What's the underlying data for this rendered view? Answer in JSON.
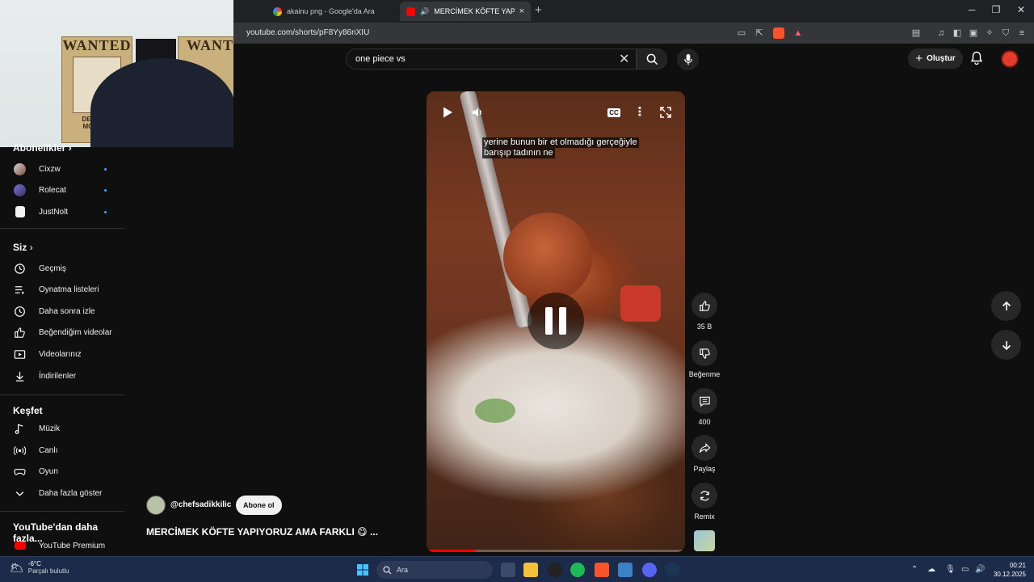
{
  "browser": {
    "tabs": [
      {
        "title": "akainu png - Google'da Ara",
        "active": false
      },
      {
        "title": "MERCİMEK KÖFTE YAPIYORUZ",
        "active": true
      }
    ],
    "url": "youtube.com/shorts/pF8Yy86nXIU",
    "new_tab_glyph": "+",
    "close_glyph": "×"
  },
  "webcam": {
    "poster_left_text": "WANTED",
    "poster_right_text": "WANT",
    "poster_name": "MONKEY",
    "poster_dead": "DEAD OR"
  },
  "youtube": {
    "search_value": "one piece vs",
    "create_label": "Oluştur",
    "brand_color": "#ff0000"
  },
  "sidebar": {
    "subscriptions_heading": "Abonelikler",
    "subscriptions": [
      {
        "name": "Cixzw"
      },
      {
        "name": "Rolecat"
      },
      {
        "name": "JustNolt"
      }
    ],
    "you_heading": "Siz",
    "you_items": [
      {
        "label": "Geçmiş",
        "icon": "history-icon"
      },
      {
        "label": "Oynatma listeleri",
        "icon": "playlist-icon"
      },
      {
        "label": "Daha sonra izle",
        "icon": "clock-icon"
      },
      {
        "label": "Beğendiğim videolar",
        "icon": "thumb-up-icon"
      },
      {
        "label": "Videolarınız",
        "icon": "video-icon"
      },
      {
        "label": "İndirilenler",
        "icon": "download-icon"
      }
    ],
    "explore_heading": "Keşfet",
    "explore_items": [
      {
        "label": "Müzik",
        "icon": "music-icon"
      },
      {
        "label": "Canlı",
        "icon": "live-icon"
      },
      {
        "label": "Oyun",
        "icon": "gamepad-icon"
      },
      {
        "label": "Daha fazla göster",
        "icon": "chevron-down-icon"
      }
    ],
    "more_heading": "YouTube'dan daha fazla...",
    "more_items": [
      {
        "label": "YouTube Premium"
      }
    ]
  },
  "short": {
    "caption_line1": "yerine bunun bir et olmadığı gerçeğiyle",
    "caption_line2": "barışıp tadının ne",
    "progress": 0.19,
    "channel": "@chefsadikkilic",
    "subscribe_label": "Abone ol",
    "title": "MERCİMEK KÖFTE YAPIYORUZ AMA FARKLI 😋 ..."
  },
  "actions": {
    "likes": "35 B",
    "dislike_label": "Beğenme",
    "comments": "400",
    "share_label": "Paylaş",
    "remix_label": "Remix"
  },
  "taskbar": {
    "weather_temp": "-6°C",
    "weather_desc": "Parçalı bulutlu",
    "search_placeholder": "Ara",
    "time": "00:21",
    "date": "30.12.2025"
  }
}
